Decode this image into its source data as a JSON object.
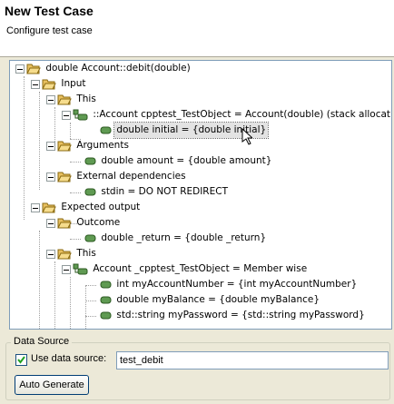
{
  "header": {
    "title": "New Test Case",
    "subtitle": "Configure test case"
  },
  "tree": {
    "nodes": [
      {
        "label": "double Account::debit(double)",
        "icon": "folder-open-icon"
      },
      {
        "label": "Input",
        "icon": "folder-open-icon"
      },
      {
        "label": "This",
        "icon": "folder-open-icon"
      },
      {
        "label": "::Account cpptest_TestObject = Account(double) (stack allocation)",
        "icon": "object-node-icon"
      },
      {
        "label": "double initial = {double initial}",
        "icon": "value-node-icon",
        "selected": true
      },
      {
        "label": "Arguments",
        "icon": "folder-open-icon"
      },
      {
        "label": "double amount = {double amount}",
        "icon": "value-node-icon"
      },
      {
        "label": "External dependencies",
        "icon": "folder-open-icon"
      },
      {
        "label": "stdin = DO NOT REDIRECT",
        "icon": "value-node-icon"
      },
      {
        "label": "Expected output",
        "icon": "folder-open-icon"
      },
      {
        "label": "Outcome",
        "icon": "folder-open-icon"
      },
      {
        "label": "double _return = {double _return}",
        "icon": "value-node-icon"
      },
      {
        "label": "This",
        "icon": "folder-open-icon"
      },
      {
        "label": "Account _cpptest_TestObject = Member wise",
        "icon": "object-node-icon"
      },
      {
        "label": "int myAccountNumber = {int myAccountNumber}",
        "icon": "value-node-icon"
      },
      {
        "label": "double myBalance = {double myBalance}",
        "icon": "value-node-icon"
      },
      {
        "label": "std::string myPassword = {std::string myPassword}",
        "icon": "value-node-icon"
      }
    ]
  },
  "data_source": {
    "group_label": "Data Source",
    "checkbox_label": "Use data source:",
    "checkbox_checked": true,
    "input_value": "test_debit",
    "auto_generate_label": "Auto Generate"
  },
  "colors": {
    "folder": "#e8c060",
    "node": "#5f9a52",
    "border": "#7f9db9",
    "background": "#ece9d8"
  }
}
